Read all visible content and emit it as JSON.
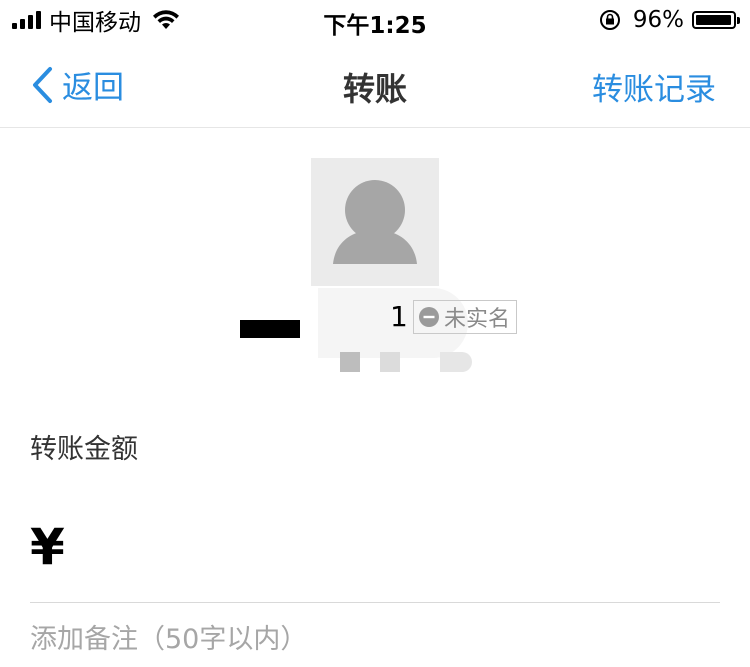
{
  "status_bar": {
    "carrier": "中国移动",
    "time": "下午1:25",
    "battery_percent": "96%",
    "battery_level": 0.96,
    "icons": [
      "signal-icon",
      "wifi-icon",
      "orientation-lock-icon",
      "battery-icon"
    ]
  },
  "nav": {
    "back_label": "返回",
    "title": "转账",
    "right_label": "转账记录",
    "icons": [
      "back-chevron-icon"
    ]
  },
  "recipient": {
    "name_visible_suffix": "1",
    "verification_badge": "未实名",
    "icons": [
      "avatar-placeholder-icon",
      "minus-circle-icon"
    ]
  },
  "amount": {
    "label": "转账金额",
    "currency_symbol": "¥",
    "value": ""
  },
  "remark": {
    "placeholder": "添加备注（50字以内）",
    "value": ""
  },
  "colors": {
    "accent": "#2a8de0",
    "text_primary": "#333333",
    "text_placeholder": "#a6a6a6",
    "divider": "#d9d9d9",
    "avatar_bg": "#ebebeb"
  }
}
